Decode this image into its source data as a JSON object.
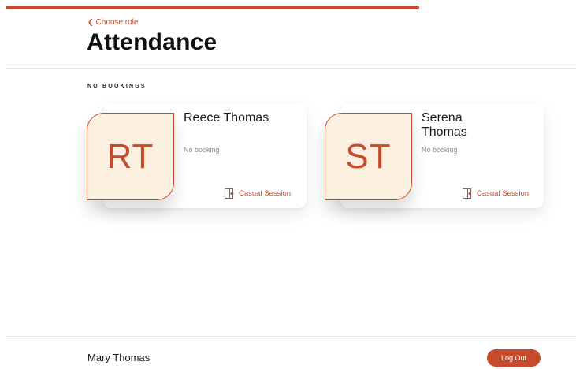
{
  "header": {
    "back_label": "Choose role",
    "back_icon": "chevron-left-icon",
    "title": "Attendance"
  },
  "section": {
    "label": "NO BOOKINGS"
  },
  "children": [
    {
      "initials": "RT",
      "name": "Reece Thomas",
      "status": "No booking",
      "action_label": "Casual Session",
      "action_icon": "door-enter-icon"
    },
    {
      "initials": "ST",
      "name": "Serena Thomas",
      "status": "No booking",
      "action_label": "Casual Session",
      "action_icon": "door-enter-icon"
    }
  ],
  "footer": {
    "user_name": "Mary Thomas",
    "logout_label": "Log Out"
  },
  "colors": {
    "accent": "#c84a2c",
    "avatar_bg": "#fcf1e1"
  }
}
